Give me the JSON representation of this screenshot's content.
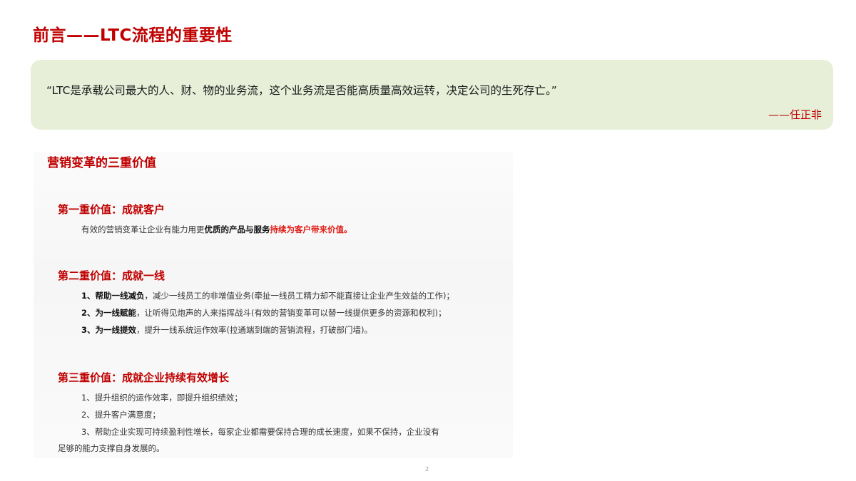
{
  "title": "前言——LTC流程的重要性",
  "quote": {
    "text": "“LTC是承载公司最大的人、财、物的业务流，这个业务流是否能高质量高效运转，决定公司的生死存亡。”",
    "author": "——任正非"
  },
  "section": {
    "heading": "营销变革的三重价值",
    "value1": {
      "title": "第一重价值：成就客户",
      "text_plain": "有效的营销变革让企业有能力用更",
      "text_bold": "优质的产品与服务",
      "text_red": "持续为客户带来价值。"
    },
    "value2": {
      "title": "第二重价值：成就一线",
      "items": [
        {
          "bold": "1、帮助一线减负",
          "text": "，减少一线员工的非增值业务(牵扯一线员工精力却不能直接让企业产生效益的工作)；"
        },
        {
          "bold": "2、为一线赋能",
          "text": "，让听得见炮声的人来指挥战斗(有效的营销变革可以替一线提供更多的资源和权利)；"
        },
        {
          "bold": "3、为一线提效",
          "text": "，提升一线系统运作效率(拉通端到端的营销流程，打破部门墙)。"
        }
      ]
    },
    "value3": {
      "title": "第三重价值：成就企业持续有效增长",
      "items": [
        "1、提升组织的运作效率，即提升组织绩效；",
        "2、提升客户满意度；",
        "3、帮助企业实现可持续盈利性增长，每家企业都需要保持合理的成长速度，如果不保持，企业没有",
        "足够的能力支撑自身发展的。"
      ]
    }
  },
  "page_number": "2",
  "colors": {
    "accent_red": "#c00000",
    "quote_bg": "#e7efd9",
    "highlight_red": "#e0201a"
  }
}
